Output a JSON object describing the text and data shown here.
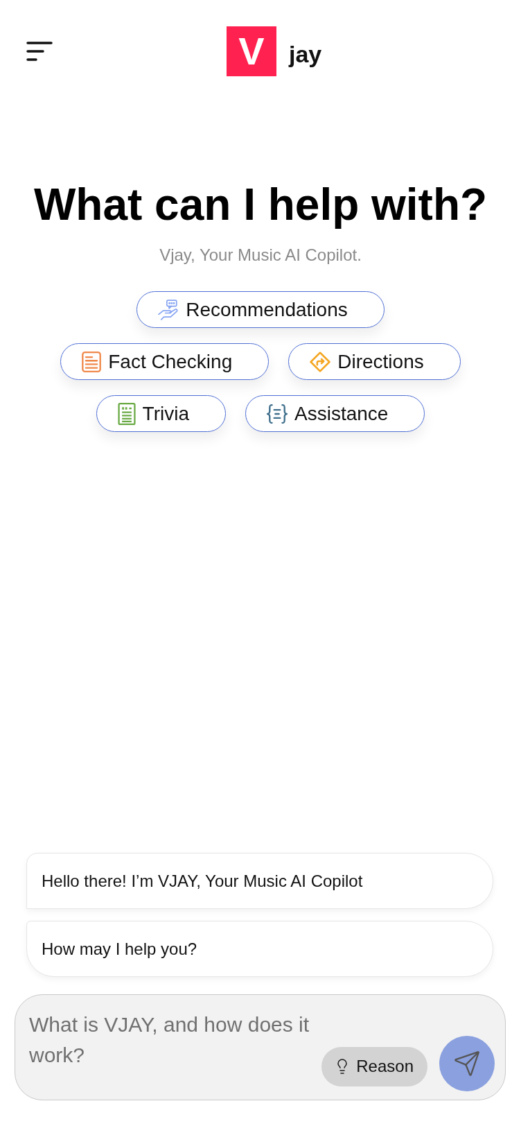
{
  "header": {
    "logo": {
      "mark": "V",
      "text": "jay"
    }
  },
  "hero": {
    "title": "What can I help with?",
    "subtitle": "Vjay, Your Music AI Copilot."
  },
  "suggestions": [
    {
      "label": "Recommendations"
    },
    {
      "label": "Fact Checking"
    },
    {
      "label": "Directions"
    },
    {
      "label": "Trivia"
    },
    {
      "label": "Assistance"
    }
  ],
  "messages": [
    {
      "text": "Hello there! I’m VJAY, Your Music AI Copilot"
    },
    {
      "text": "How may I help you?"
    }
  ],
  "composer": {
    "placeholder": "What is VJAY, and how does it work?",
    "reason_button": {
      "label": "Reason"
    }
  }
}
